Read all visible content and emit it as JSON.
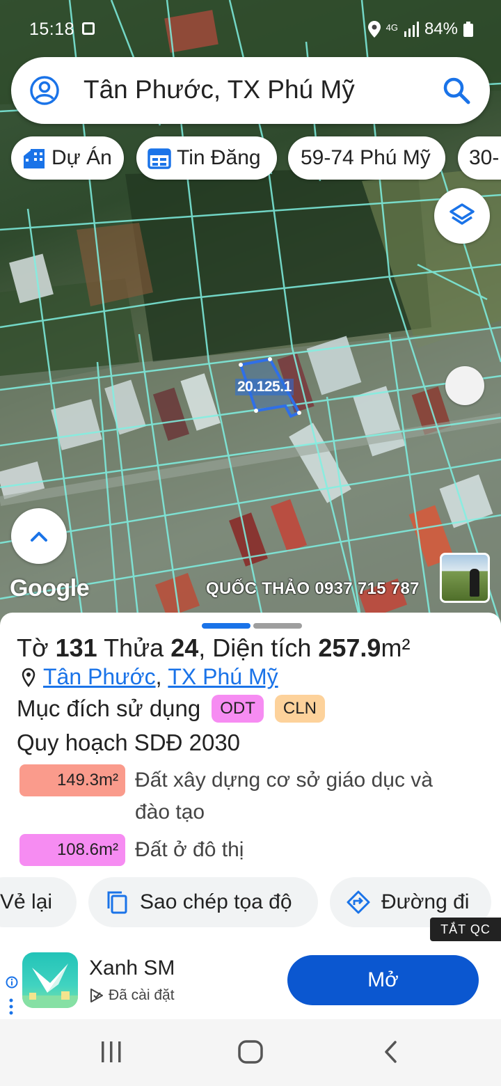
{
  "status_bar": {
    "time": "15:18",
    "network": "4G",
    "battery": "84%"
  },
  "search": {
    "query": "Tân Phước, TX Phú Mỹ"
  },
  "chips": [
    {
      "label": "Dự Án",
      "icon": "building-icon"
    },
    {
      "label": "Tin Đăng",
      "icon": "calendar-icon"
    },
    {
      "label": "59-74 Phú Mỹ",
      "icon": ""
    },
    {
      "label": "30-",
      "icon": ""
    }
  ],
  "map": {
    "parcel_label": "20.125.1",
    "attribution": "Google",
    "watermark": "QUỐC THẢO 0937 715 787"
  },
  "parcel": {
    "sheet_label": "Tờ",
    "sheet_no": "131",
    "plot_label": "Thửa",
    "plot_no": "24",
    "area_label": ", Diện tích",
    "area_value": "257.9",
    "area_unit": "m²",
    "location_ward": "Tân Phước",
    "location_sep": ", ",
    "location_town": "TX Phú Mỹ",
    "purpose_label": "Mục đích sử dụng",
    "tags": [
      {
        "text": "ODT",
        "color": "#f68cf2"
      },
      {
        "text": "CLN",
        "color": "#fdd29b"
      }
    ],
    "plan_title": "Quy hoạch SDĐ 2030",
    "plan_items": [
      {
        "area": "149.3m²",
        "desc": "Đất xây dựng cơ sở giáo dục và đào tạo",
        "color": "#fa9b8c"
      },
      {
        "area": "108.6m²",
        "desc": "Đất ở đô thị",
        "color": "#f68cf2"
      }
    ]
  },
  "actions": [
    {
      "label": "Vẻ lại",
      "icon": ""
    },
    {
      "label": "Sao chép tọa độ",
      "icon": "copy-icon"
    },
    {
      "label": "Đường đi",
      "icon": "directions-icon"
    }
  ],
  "ad": {
    "close_label": "TẮT QC",
    "app_name": "Xanh SM",
    "status": "Đã cài đặt",
    "open_label": "Mở"
  },
  "colors": {
    "accent": "#1a73e8",
    "primary_button": "#0b57d0",
    "parcel_lines": "#7ff0e2",
    "selected_parcel": "#2f6fe8"
  }
}
